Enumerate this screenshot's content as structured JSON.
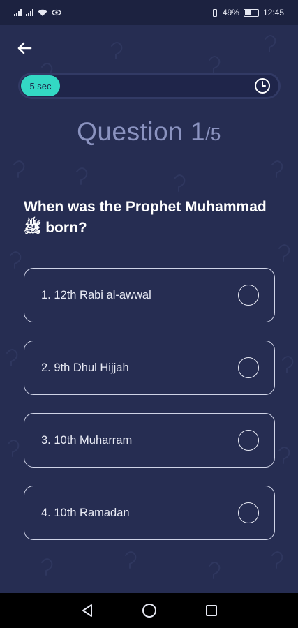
{
  "status_bar": {
    "battery": "49%",
    "time": "12:45"
  },
  "timer": {
    "label": "5 sec",
    "remaining_fraction": 0.15
  },
  "question": {
    "prefix": "Question ",
    "number": "1",
    "total": "/5",
    "text": "When was the Prophet Muhammad ﷺ born?"
  },
  "options": [
    "1. 12th Rabi al-awwal",
    "2. 9th Dhul Hijjah",
    "3. 10th Muharram",
    "4. 10th Ramadan"
  ],
  "colors": {
    "background": "#262d52",
    "accent": "#33d8c4",
    "header_text": "#8b93c0"
  }
}
